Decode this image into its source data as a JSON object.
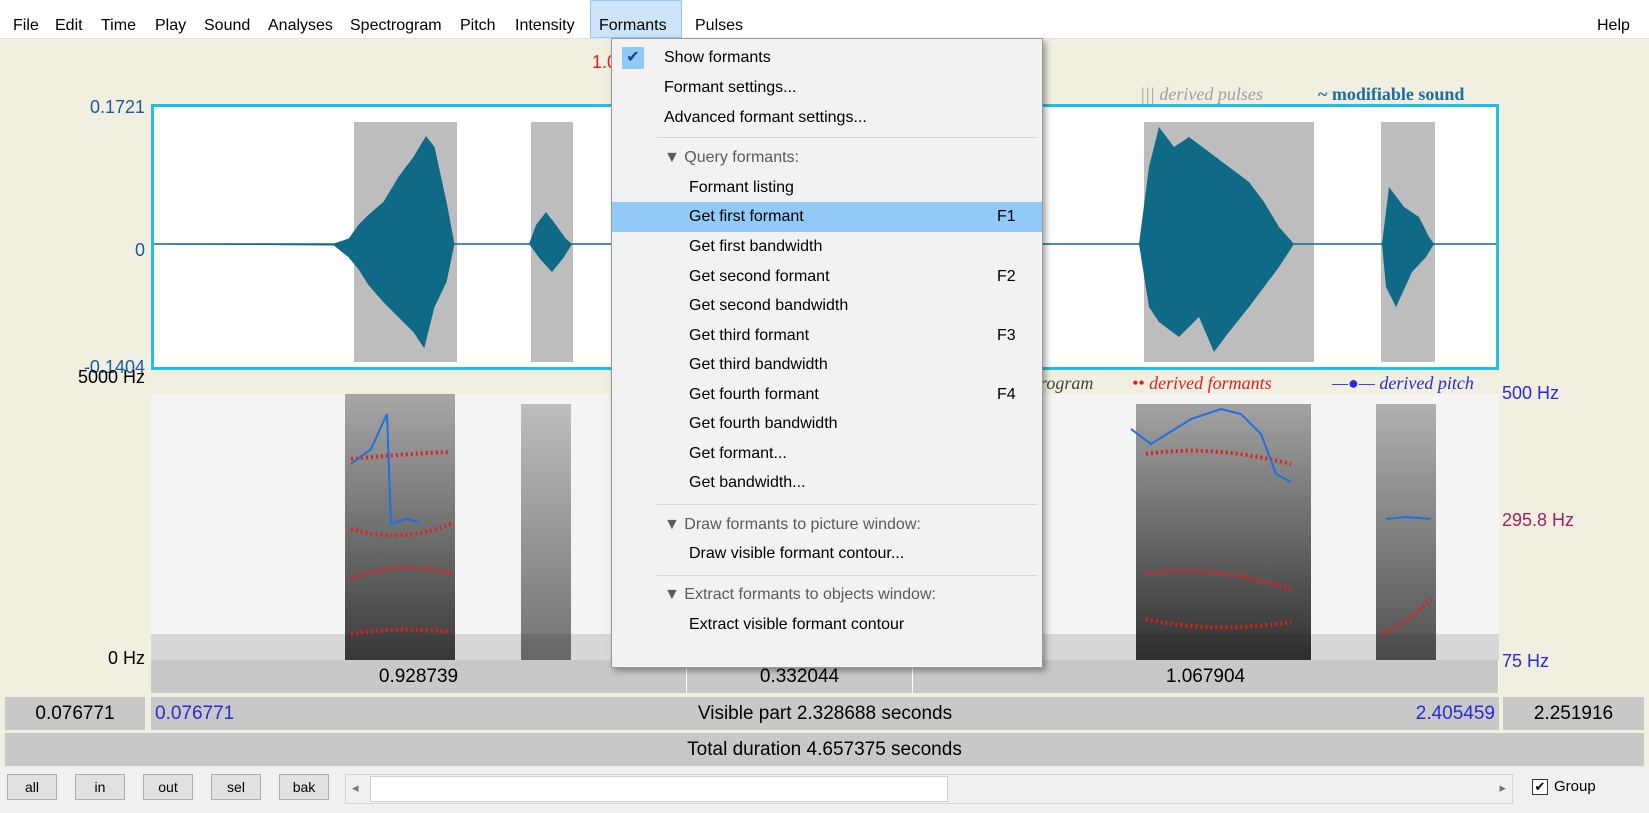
{
  "menubar": {
    "items": [
      "File",
      "Edit",
      "Time",
      "Play",
      "Sound",
      "Analyses",
      "Spectrogram",
      "Pitch",
      "Intensity",
      "Formants",
      "Pulses"
    ],
    "help": "Help",
    "active": "Formants"
  },
  "waveform": {
    "cursor_time_partial": "1.0",
    "ymax": "0.1721",
    "ymid": "0",
    "ymin": "-0.1404",
    "legend_pulses_mark": "|||",
    "legend_pulses": "derived pulses",
    "legend_sound_mark": "~",
    "legend_sound": "modifiable sound"
  },
  "spectrogram": {
    "freq_max": "5000 Hz",
    "freq_min": "0 Hz",
    "pitch_max": "500 Hz",
    "pitch_cursor": "295.8 Hz",
    "pitch_min": "75 Hz",
    "legend_spectrogram_partial": "rogram",
    "legend_formants_mark": "••",
    "legend_formants": "derived formants",
    "legend_pitch_mark": "—●—",
    "legend_pitch": "derived pitch"
  },
  "segments": [
    "0.928739",
    "0.332044",
    "1.067904"
  ],
  "visible": {
    "left_outer": "0.076771",
    "left_inner": "0.076771",
    "label": "Visible part 2.328688 seconds",
    "right_inner": "2.405459",
    "right_outer": "2.251916"
  },
  "total": "Total duration 4.657375 seconds",
  "buttons": [
    "all",
    "in",
    "out",
    "sel",
    "bak"
  ],
  "group_label": "Group",
  "group_checked": true,
  "formants_menu": {
    "show_formants": "Show formants",
    "formant_settings": "Formant settings...",
    "advanced_settings": "Advanced formant settings...",
    "query_header": "▼ Query formants:",
    "query_items": [
      {
        "label": "Formant listing",
        "shortcut": ""
      },
      {
        "label": "Get first formant",
        "shortcut": "F1"
      },
      {
        "label": "Get first bandwidth",
        "shortcut": ""
      },
      {
        "label": "Get second formant",
        "shortcut": "F2"
      },
      {
        "label": "Get second bandwidth",
        "shortcut": ""
      },
      {
        "label": "Get third formant",
        "shortcut": "F3"
      },
      {
        "label": "Get third bandwidth",
        "shortcut": ""
      },
      {
        "label": "Get fourth formant",
        "shortcut": "F4"
      },
      {
        "label": "Get fourth bandwidth",
        "shortcut": ""
      },
      {
        "label": "Get formant...",
        "shortcut": ""
      },
      {
        "label": "Get bandwidth...",
        "shortcut": ""
      }
    ],
    "draw_header": "▼ Draw formants to picture window:",
    "draw_item": "Draw visible formant contour...",
    "extract_header": "▼ Extract formants to objects window:",
    "extract_item": "Extract visible formant contour",
    "selected": "Get first formant"
  },
  "colors": {
    "waveform": "#0e6a86",
    "selection_border": "#1fbfe6",
    "formant_dots": "#e02020",
    "pitch_line": "#1e6fe0",
    "menu_highlight": "#91c9f7"
  }
}
